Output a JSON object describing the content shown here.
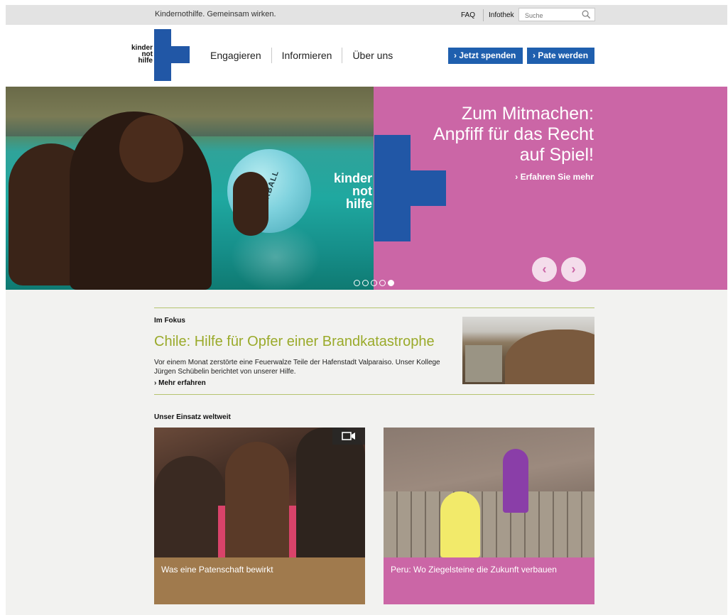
{
  "topbar": {
    "tagline": "Kindernothilfe. Gemeinsam wirken.",
    "faq": "FAQ",
    "infothek": "Infothek",
    "search_placeholder": "Suche"
  },
  "header": {
    "logo_lines": [
      "kinder",
      "not",
      "hilfe"
    ],
    "nav": [
      "Engagieren",
      "Informieren",
      "Über uns"
    ],
    "donate_button": "Jetzt spenden",
    "sponsor_button": "Pate werden"
  },
  "hero": {
    "logo_lines": [
      "kinder",
      "not",
      "hilfe"
    ],
    "headline": "Zum Mitmachen: Anpfiff für das Recht auf Spiel!",
    "cta": "Erfahren Sie mehr",
    "ball_text": "VERBALL",
    "slides_total": 5,
    "active_slide": 5
  },
  "focus": {
    "label": "Im Fokus",
    "title": "Chile: Hilfe für Opfer einer Brandkatastrophe",
    "text": "Vor einem Monat zerstörte eine Feuerwalze Teile der Hafenstadt Valparaiso. Unser Kollege Jürgen Schübelin berichtet von unserer Hilfe.",
    "more": "Mehr erfahren"
  },
  "worldwide": {
    "label": "Unser Einsatz weltweit",
    "cards": [
      {
        "caption": "Was eine Patenschaft bewirkt",
        "color": "#a07a4d",
        "video": true
      },
      {
        "caption": "Peru: Wo Ziegelsteine die Zukunft verbauen",
        "color": "#cb66a6",
        "video": false
      }
    ]
  },
  "colors": {
    "brand_blue": "#2157a6",
    "hero_pink": "#cb66a6",
    "accent_green": "#9aaa2a",
    "card_brown": "#a07a4d"
  }
}
